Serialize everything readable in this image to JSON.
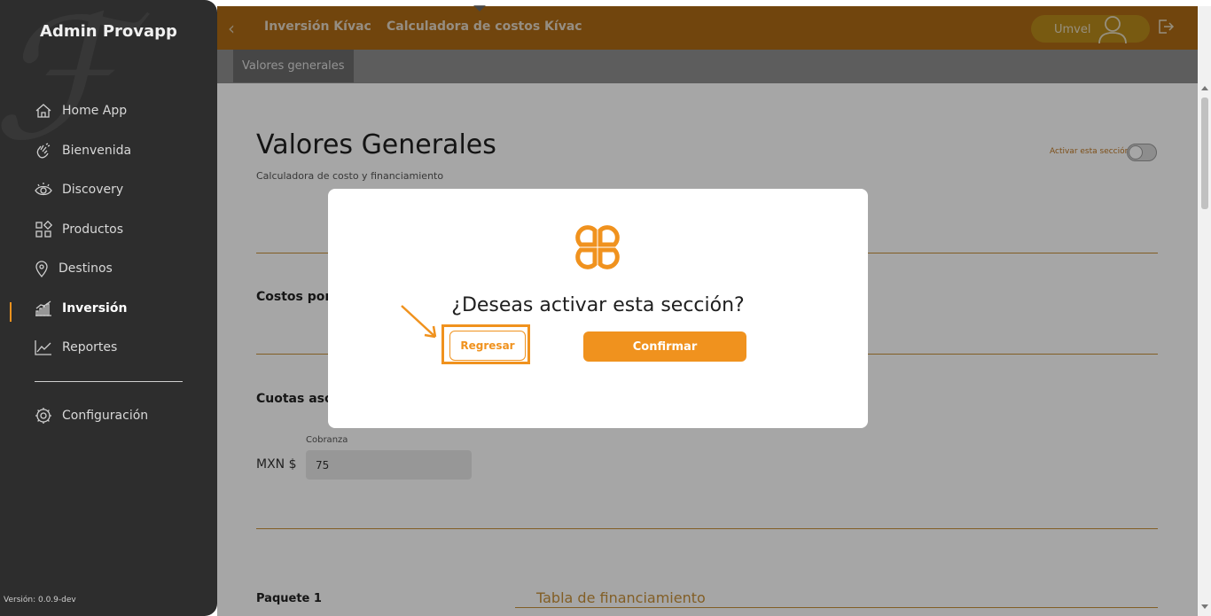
{
  "sidebar": {
    "title": "Admin Provapp",
    "items": [
      {
        "label": "Home App",
        "icon": "home-icon"
      },
      {
        "label": "Bienvenida",
        "icon": "wave-hand-icon"
      },
      {
        "label": "Discovery",
        "icon": "eye-icon"
      },
      {
        "label": "Productos",
        "icon": "grid-icon"
      },
      {
        "label": "Destinos",
        "icon": "location-pin-icon"
      },
      {
        "label": "Inversión",
        "icon": "bar-chart-icon",
        "active": true
      },
      {
        "label": "Reportes",
        "icon": "line-chart-icon"
      },
      {
        "label": "Configuración",
        "icon": "gear-icon"
      }
    ],
    "version": "Versión: 0.0.9-dev"
  },
  "topbar": {
    "crumbs": [
      "Inversión Kívac",
      "Calculadora de costos Kívac"
    ],
    "user": "Umvel"
  },
  "subtabs": [
    "Valores generales"
  ],
  "main": {
    "title": "Valores Generales",
    "subtitle": "Calculadora de costo y financiamiento",
    "toggle_label": "Activar esta sección",
    "section1": "Costos por",
    "section2": "Cuotas aso",
    "field_label": "Cobranza",
    "currency": "MXN $",
    "field_value": "75",
    "package_title": "Paquete 1",
    "table_label": "Tabla de financiamiento"
  },
  "modal": {
    "question": "¿Deseas activar esta sección?",
    "back_label": "Regresar",
    "confirm_label": "Confirmar"
  },
  "colors": {
    "accent": "#f0921e",
    "sidebar_bg": "#2d2d2d",
    "topbar_bg": "#ae6a15"
  }
}
